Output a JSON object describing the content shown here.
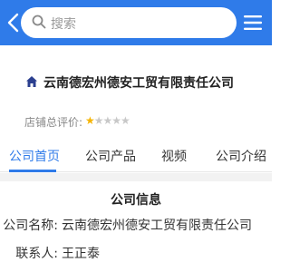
{
  "header": {
    "search_placeholder": "搜索",
    "back_icon": "chevron-left-icon",
    "search_icon": "search-icon",
    "menu_icon": "menu-icon",
    "accent": "#2f7be9"
  },
  "company": {
    "name": "云南德宏州德安工贸有限责任公司",
    "home_icon": "home-icon"
  },
  "rating": {
    "label": "店铺总评价:",
    "value": 1,
    "max": 5,
    "stars_text_on": "★",
    "stars_text_off": "★★★★"
  },
  "tabs": [
    {
      "label": "公司首页"
    },
    {
      "label": "公司产品"
    },
    {
      "label": "视频"
    },
    {
      "label": "公司介绍"
    }
  ],
  "info": {
    "title": "公司信息",
    "company_label": "公司名称:",
    "company_value": "云南德宏州德安工贸有限责任公司",
    "contact_label": "联系人:",
    "contact_value": "王正泰"
  }
}
